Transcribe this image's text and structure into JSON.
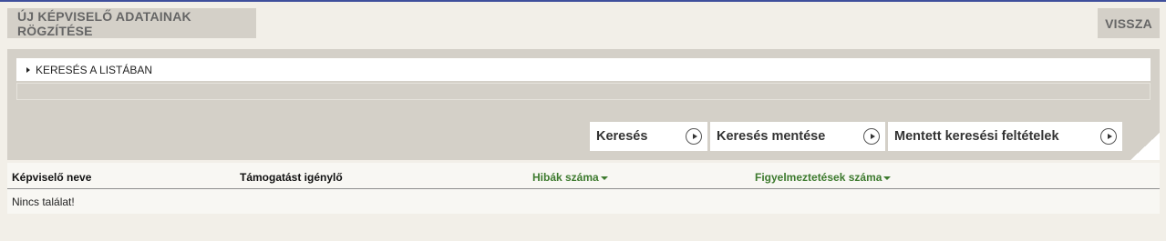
{
  "header": {
    "title_button": "ÚJ KÉPVISELŐ ADATAINAK RÖGZÍTÉSE",
    "back_button": "VISSZA"
  },
  "search_panel": {
    "toggle_label": "KERESÉS A LISTÁBAN",
    "buttons": {
      "search": "Keresés",
      "save_search": "Keresés mentése",
      "saved_criteria": "Mentett keresési feltételek"
    }
  },
  "table": {
    "columns": [
      {
        "label": "Képviselő neve",
        "sortable": false
      },
      {
        "label": "Támogatást igénylő",
        "sortable": false
      },
      {
        "label": "Hibák száma",
        "sortable": true
      },
      {
        "label": "Figyelmeztetések száma",
        "sortable": true
      }
    ],
    "empty_message": "Nincs találat!"
  },
  "colors": {
    "top_line": "#3f4f9c",
    "page_bg": "#f2efe8",
    "panel_bg": "#d4d0c8",
    "sortable_header": "#3d7a2e"
  }
}
